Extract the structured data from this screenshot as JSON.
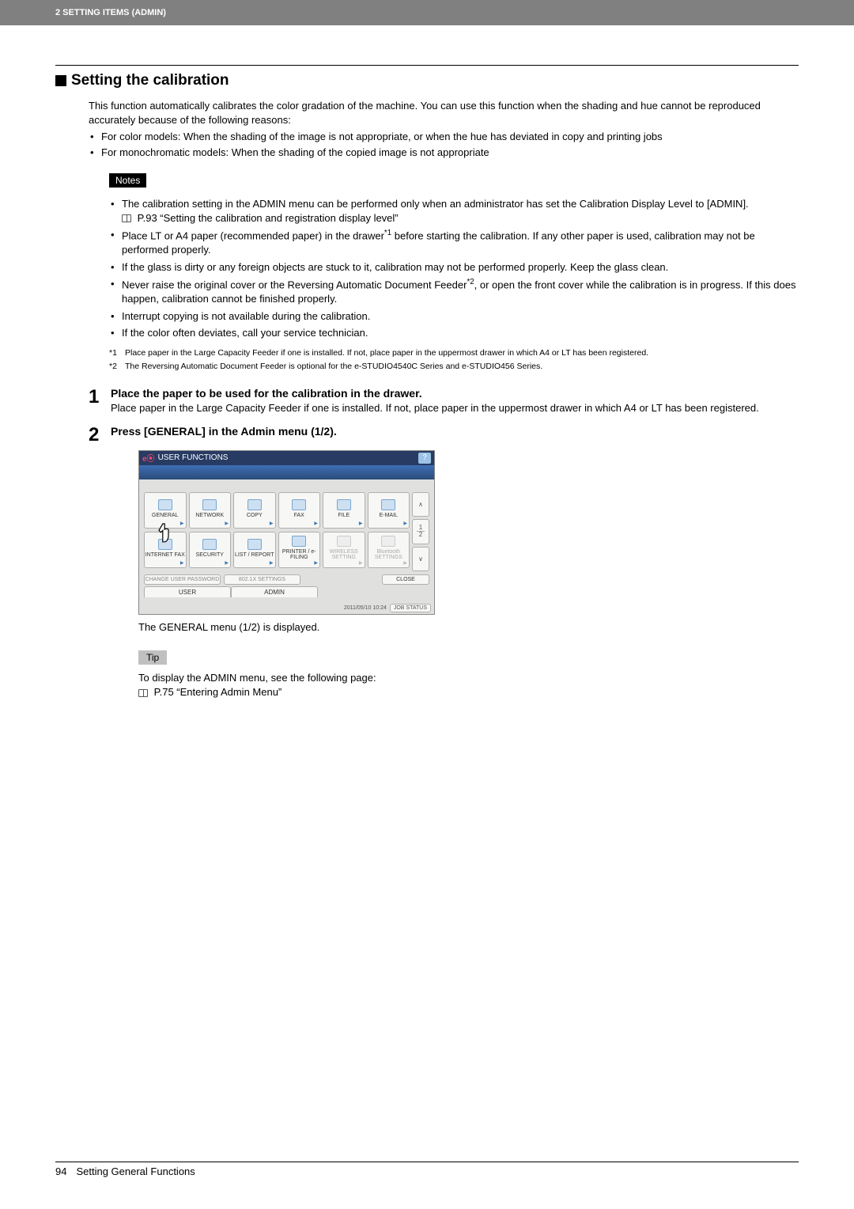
{
  "header": {
    "crumb": "2 SETTING ITEMS (ADMIN)"
  },
  "section": {
    "title": "Setting the calibration",
    "intro": "This function automatically calibrates the color gradation of the machine. You can use this function when the shading and hue cannot be reproduced accurately because of the following reasons:",
    "bullets": [
      "For color models: When the shading of the image is not appropriate, or when the hue has deviated in copy and printing jobs",
      "For monochromatic models: When the shading of the copied image is not appropriate"
    ]
  },
  "notes": {
    "label": "Notes",
    "items": [
      {
        "text": "The calibration setting in the ADMIN menu can be performed only when an administrator has set the Calibration Display Level to [ADMIN].",
        "ref": "P.93 “Setting the calibration and registration display level”"
      },
      {
        "text_html": "Place LT or A4 paper (recommended paper) in the drawer<sup>*1</sup> before starting the calibration. If any other paper is used, calibration may not be performed properly."
      },
      {
        "text": "If the glass is dirty or any foreign objects are stuck to it, calibration may not be performed properly. Keep the glass clean."
      },
      {
        "text_html": "Never raise the original cover or the Reversing Automatic Document Feeder<sup>*2</sup>, or open the front cover while the calibration is in progress. If this does happen, calibration cannot be finished properly."
      },
      {
        "text": "Interrupt copying is not available during the calibration."
      },
      {
        "text": "If the color often deviates, call your service technician."
      }
    ]
  },
  "footnotes": [
    {
      "mark": "*1",
      "text": "Place paper in the Large Capacity Feeder if one is installed. If not, place paper in the uppermost drawer in which A4 or LT has been registered."
    },
    {
      "mark": "*2",
      "text": "The Reversing Automatic Document Feeder is optional for the e-STUDIO4540C Series and e-STUDIO456 Series."
    }
  ],
  "steps": {
    "s1": {
      "num": "1",
      "title": "Place the paper to be used for the calibration in the drawer.",
      "text": "Place paper in the Large Capacity Feeder if one is installed. If not, place paper in the uppermost drawer in which A4 or LT has been registered."
    },
    "s2": {
      "num": "2",
      "title": "Press [GENERAL] in the Admin menu (1/2).",
      "after": "The GENERAL menu (1/2) is displayed."
    }
  },
  "screen": {
    "title": "USER FUNCTIONS",
    "help": "?",
    "row1": [
      "GENERAL",
      "NETWORK",
      "COPY",
      "FAX",
      "FILE",
      "E-MAIL"
    ],
    "row2": [
      "INTERNET FAX",
      "SECURITY",
      "LIST / REPORT",
      "PRINTER / e-FILING",
      "WIRELESS SETTING",
      "Bluetooth SETTINGS"
    ],
    "page_indicator": {
      "cur": "1",
      "total": "2"
    },
    "bottom_buttons": [
      "CHANGE USER PASSWORD",
      "802.1X SETTINGS"
    ],
    "close": "CLOSE",
    "tabs": [
      "USER",
      "ADMIN"
    ],
    "timestamp": "2011/05/10 10:24",
    "jobstatus": "JOB STATUS"
  },
  "tip": {
    "label": "Tip",
    "text": "To display the ADMIN menu, see the following page:",
    "ref": "P.75 “Entering Admin Menu”"
  },
  "footer": {
    "page": "94",
    "title": "Setting General Functions"
  }
}
